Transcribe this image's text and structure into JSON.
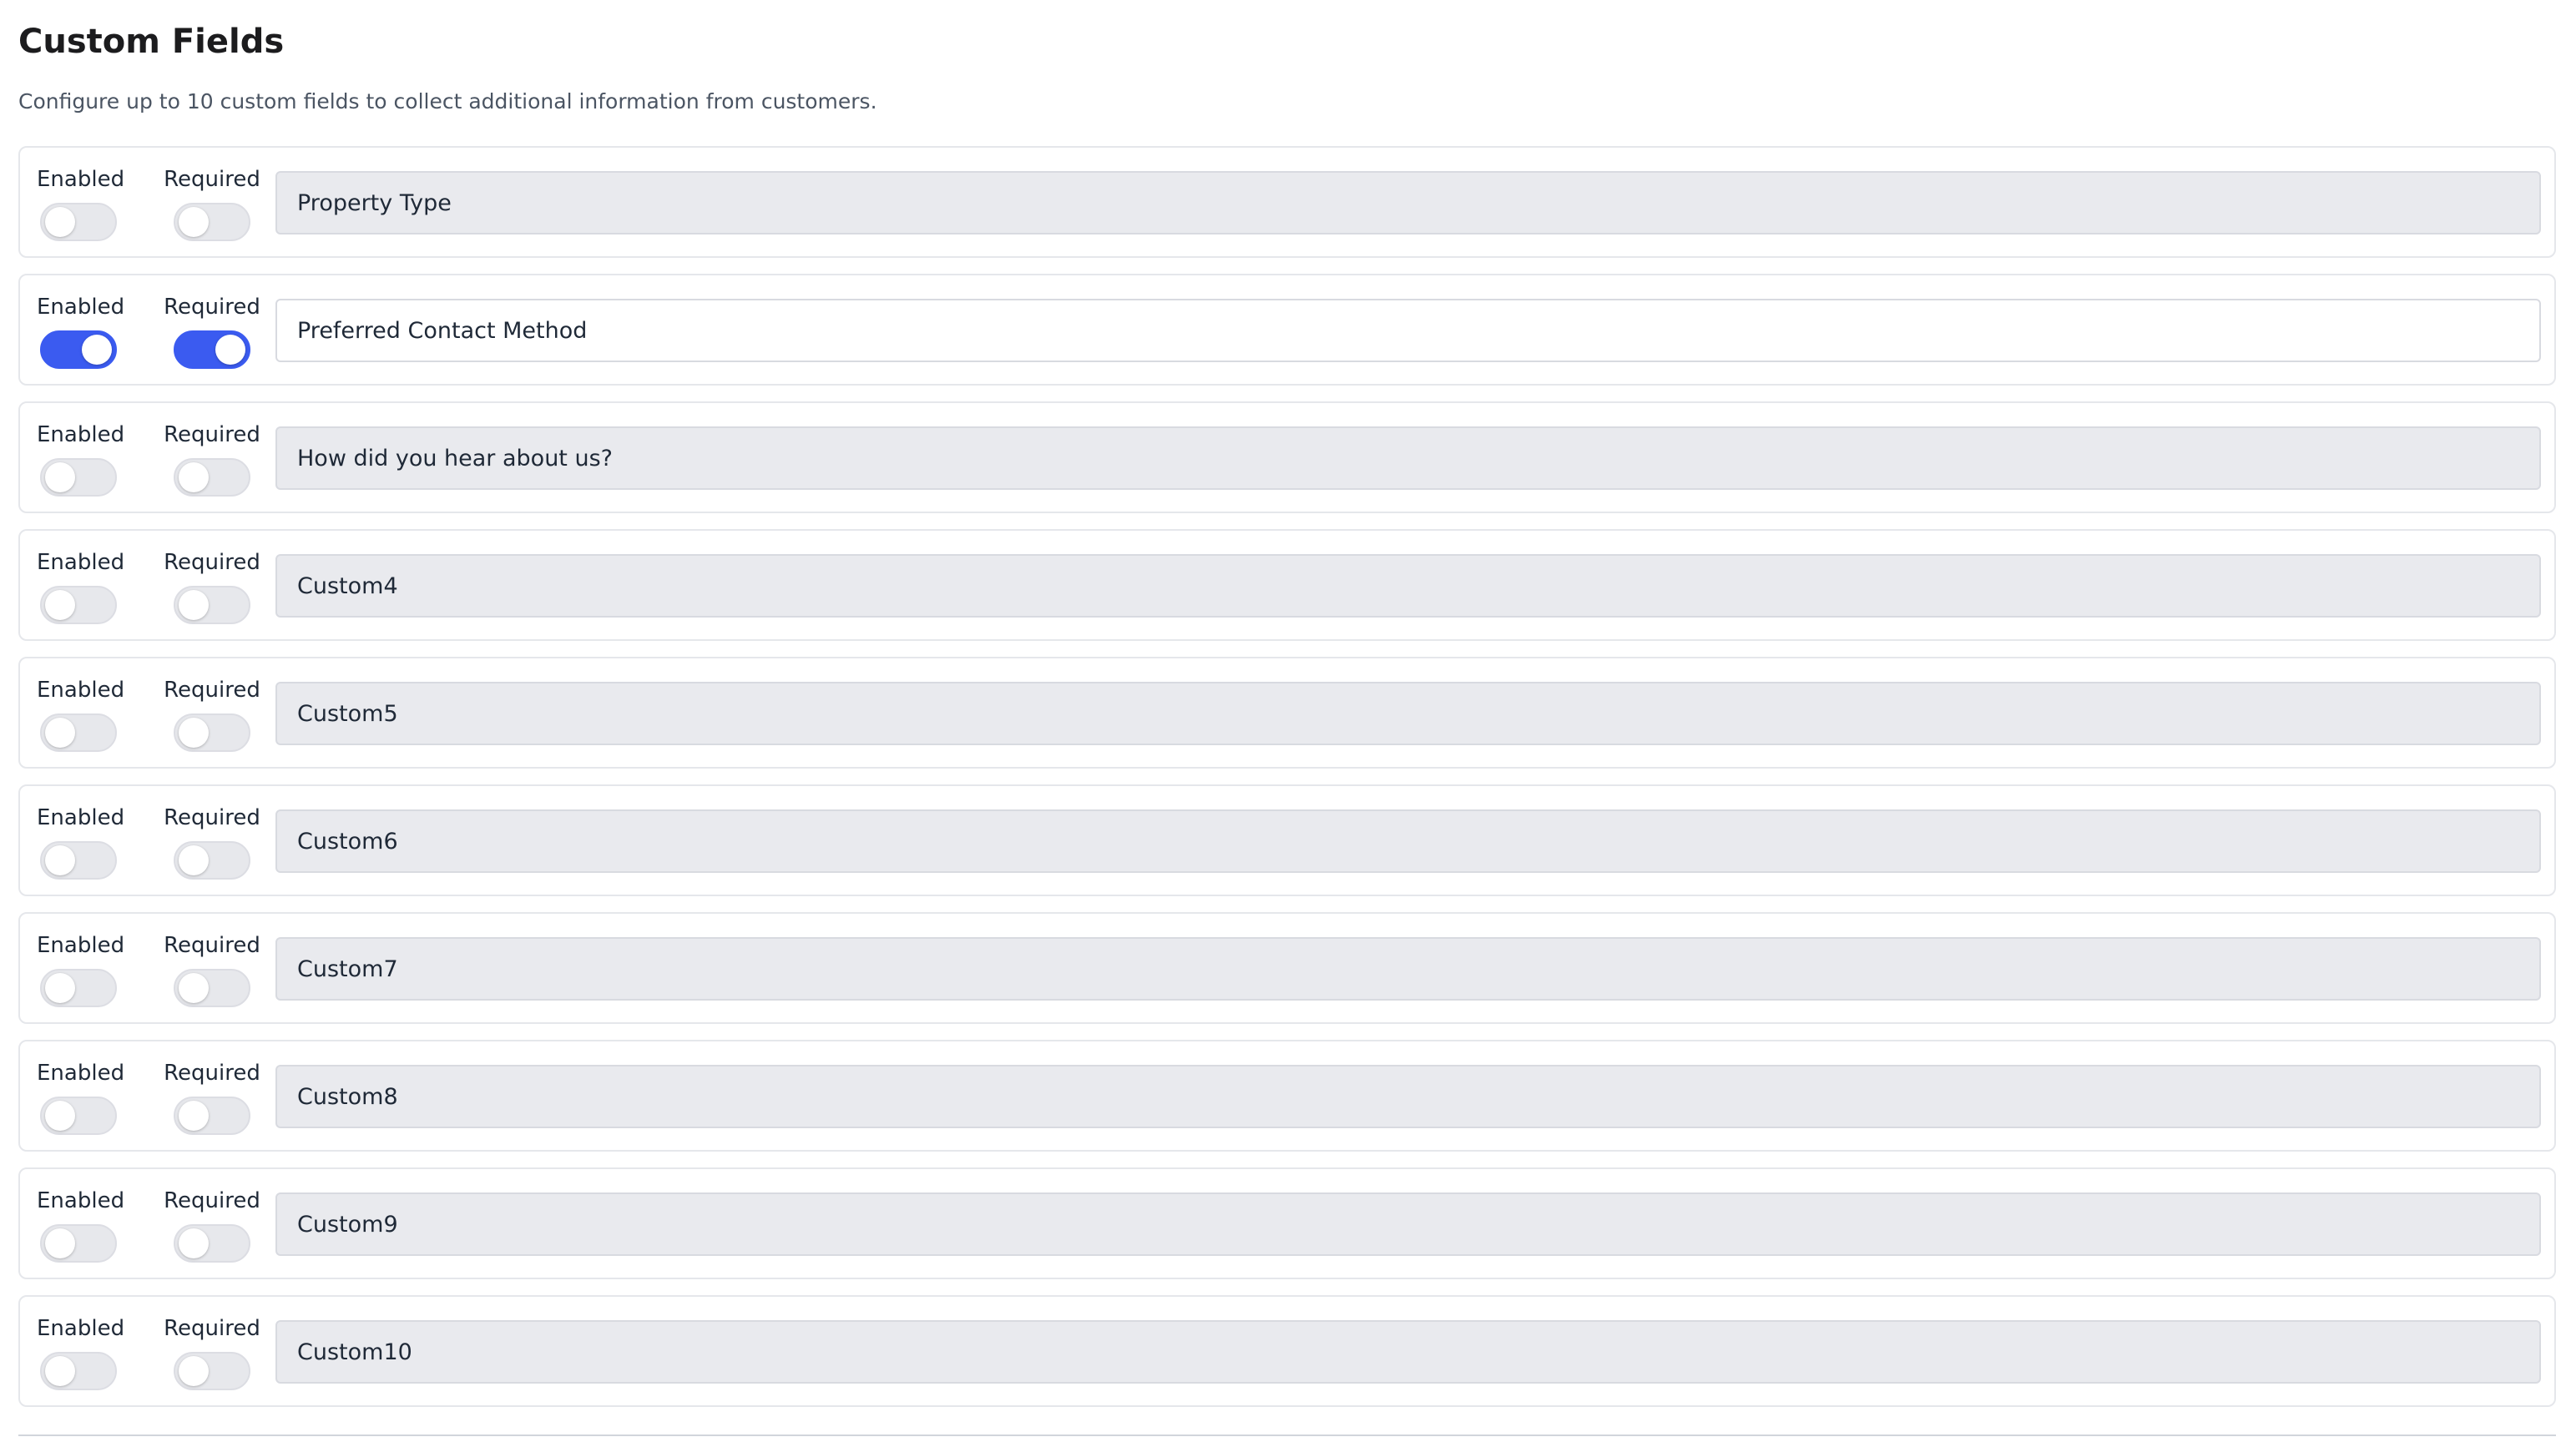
{
  "header": {
    "title": "Custom Fields",
    "subtitle": "Configure up to 10 custom fields to collect additional information from customers."
  },
  "labels": {
    "enabled": "Enabled",
    "required": "Required"
  },
  "colors": {
    "toggle_on": "#3b5bf0",
    "toggle_off": "#e7e8ec",
    "field_disabled_bg": "#e9eaee",
    "field_enabled_bg": "#ffffff"
  },
  "fields": [
    {
      "value": "Property Type",
      "enabled": false,
      "required": false
    },
    {
      "value": "Preferred Contact Method",
      "enabled": true,
      "required": true
    },
    {
      "value": "How did you hear about us?",
      "enabled": false,
      "required": false
    },
    {
      "value": "Custom4",
      "enabled": false,
      "required": false
    },
    {
      "value": "Custom5",
      "enabled": false,
      "required": false
    },
    {
      "value": "Custom6",
      "enabled": false,
      "required": false
    },
    {
      "value": "Custom7",
      "enabled": false,
      "required": false
    },
    {
      "value": "Custom8",
      "enabled": false,
      "required": false
    },
    {
      "value": "Custom9",
      "enabled": false,
      "required": false
    },
    {
      "value": "Custom10",
      "enabled": false,
      "required": false
    }
  ]
}
